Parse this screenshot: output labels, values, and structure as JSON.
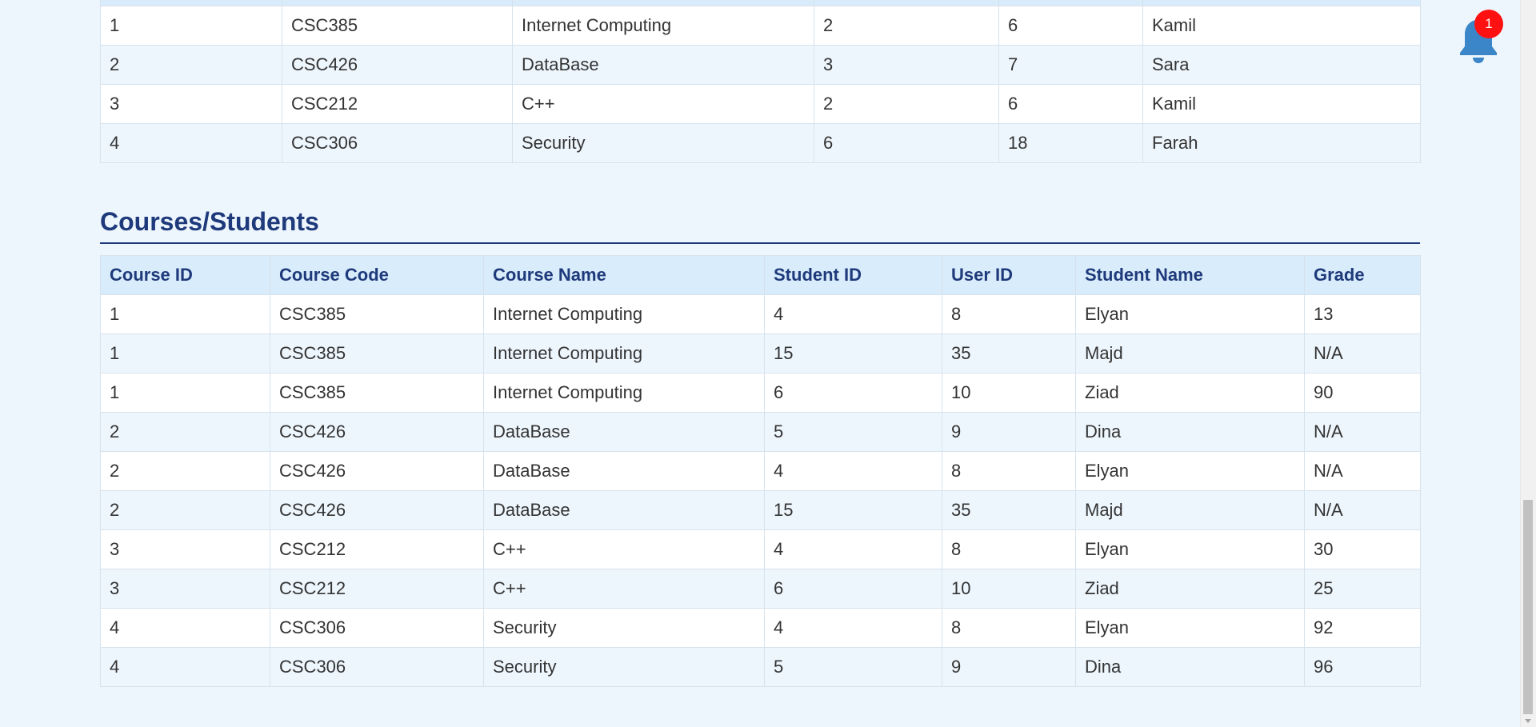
{
  "courses_table": {
    "headers": [
      "",
      "",
      "",
      "",
      "",
      ""
    ],
    "rows": [
      [
        "1",
        "CSC385",
        "Internet Computing",
        "2",
        "6",
        "Kamil"
      ],
      [
        "2",
        "CSC426",
        "DataBase",
        "3",
        "7",
        "Sara"
      ],
      [
        "3",
        "CSC212",
        "C++",
        "2",
        "6",
        "Kamil"
      ],
      [
        "4",
        "CSC306",
        "Security",
        "6",
        "18",
        "Farah"
      ]
    ]
  },
  "courses_students": {
    "title": "Courses/Students",
    "headers": [
      "Course ID",
      "Course Code",
      "Course Name",
      "Student ID",
      "User ID",
      "Student Name",
      "Grade"
    ],
    "rows": [
      [
        "1",
        "CSC385",
        "Internet Computing",
        "4",
        "8",
        "Elyan",
        "13"
      ],
      [
        "1",
        "CSC385",
        "Internet Computing",
        "15",
        "35",
        "Majd",
        "N/A"
      ],
      [
        "1",
        "CSC385",
        "Internet Computing",
        "6",
        "10",
        "Ziad",
        "90"
      ],
      [
        "2",
        "CSC426",
        "DataBase",
        "5",
        "9",
        "Dina",
        "N/A"
      ],
      [
        "2",
        "CSC426",
        "DataBase",
        "4",
        "8",
        "Elyan",
        "N/A"
      ],
      [
        "2",
        "CSC426",
        "DataBase",
        "15",
        "35",
        "Majd",
        "N/A"
      ],
      [
        "3",
        "CSC212",
        "C++",
        "4",
        "8",
        "Elyan",
        "30"
      ],
      [
        "3",
        "CSC212",
        "C++",
        "6",
        "10",
        "Ziad",
        "25"
      ],
      [
        "4",
        "CSC306",
        "Security",
        "4",
        "8",
        "Elyan",
        "92"
      ],
      [
        "4",
        "CSC306",
        "Security",
        "5",
        "9",
        "Dina",
        "96"
      ]
    ]
  },
  "notifications": {
    "icon": "bell-icon",
    "count": "1",
    "bell_color": "#3a86c8",
    "badge_color": "#ff1111"
  },
  "colors": {
    "heading": "#1e3a7b",
    "header_bg": "#d9ecfb",
    "page_bg": "#eef6fd"
  }
}
